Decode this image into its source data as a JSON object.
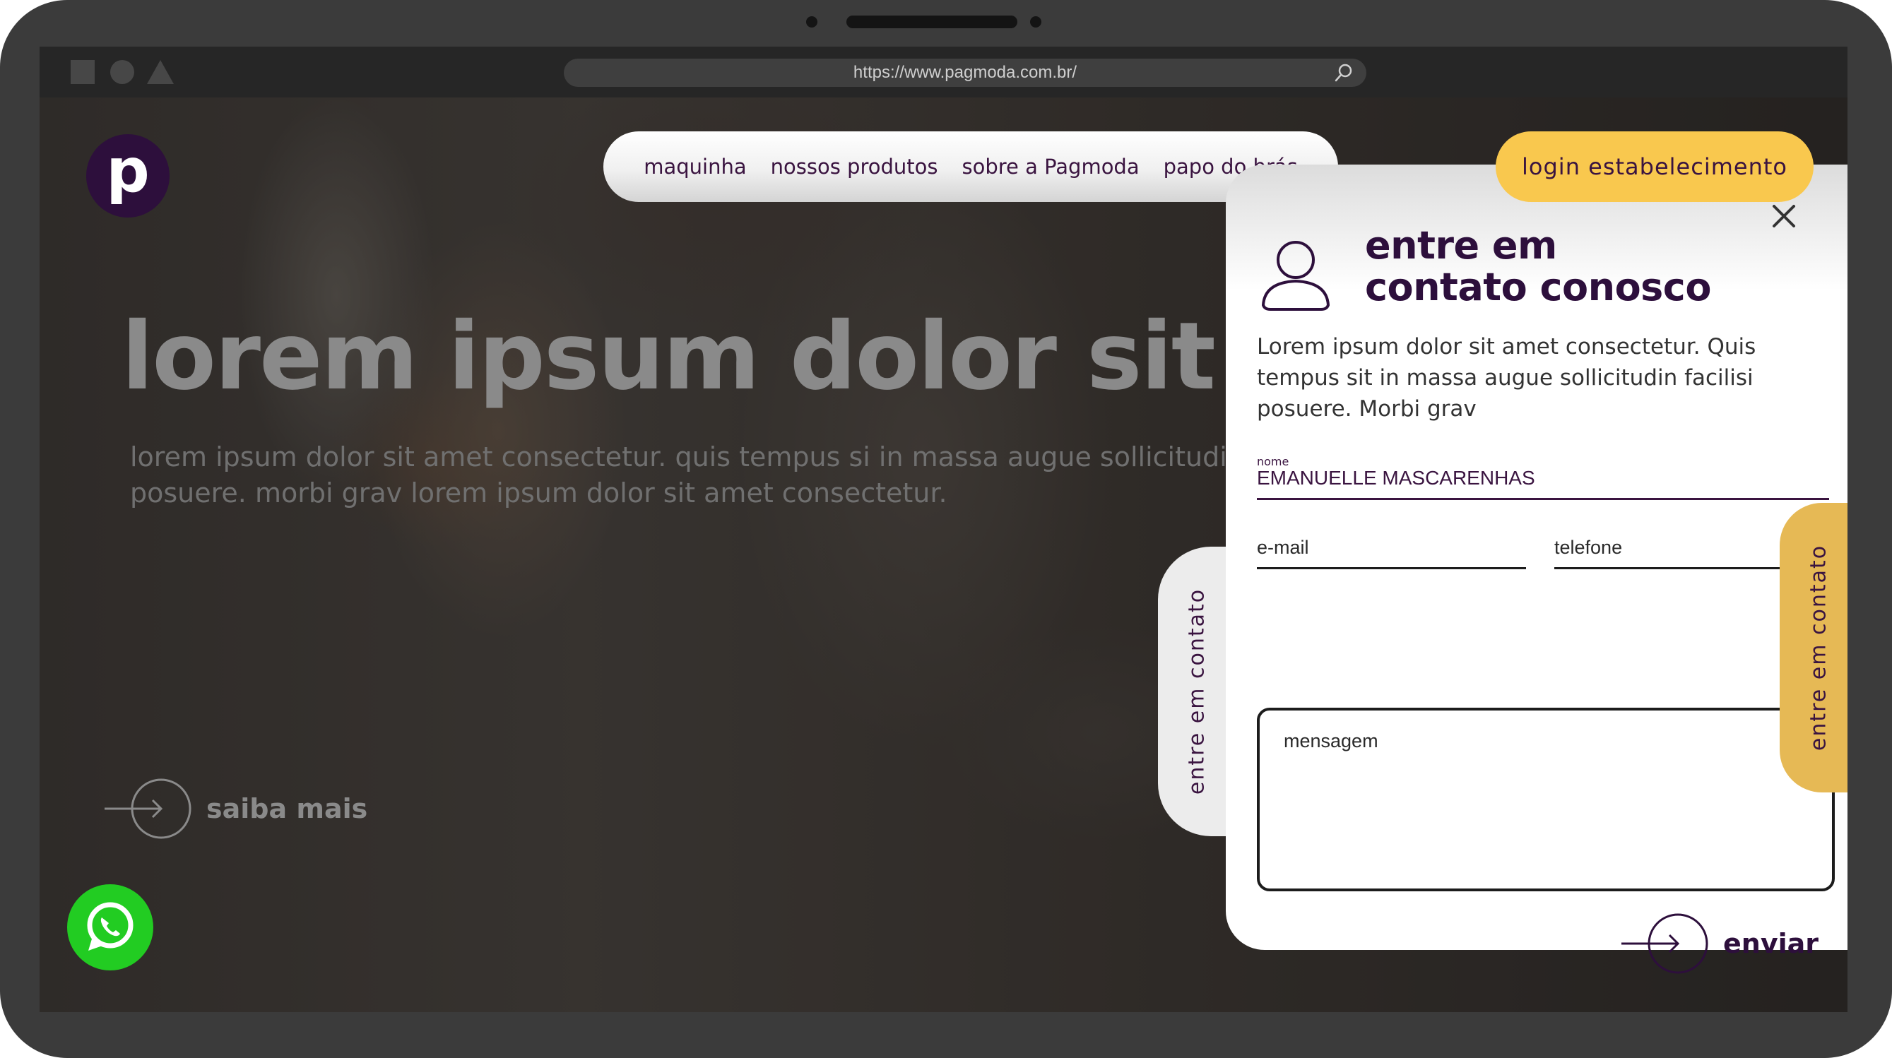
{
  "browser": {
    "url": "https://www.pagmoda.com.br/"
  },
  "site": {
    "logo_letter": "p",
    "nav": [
      {
        "label": "maquinha"
      },
      {
        "label": "nossos produtos"
      },
      {
        "label": "sobre a Pagmoda"
      },
      {
        "label": "papo do brás"
      }
    ],
    "login_label": "login estabelecimento"
  },
  "hero": {
    "title": "lorem ipsum dolor sit",
    "subtitle": "lorem ipsum dolor sit amet consectetur. quis tempus si in massa augue sollicitudi\nposuere. morbi grav lorem ipsum dolor sit amet consectetur.",
    "cta_label": "saiba mais"
  },
  "side_tabs": {
    "left_label": "entre em contato",
    "right_label": "entre em contato"
  },
  "contact_modal": {
    "title": "entre em\ncontato conosco",
    "description": "Lorem ipsum dolor sit amet consectetur. Quis tempus sit in massa augue sollicitudin facilisi posuere. Morbi grav",
    "name_label": "nome",
    "name_value": "EMANUELLE MASCARENHAS",
    "email_label": "e-mail",
    "phone_label": "telefone",
    "message_label": "mensagem",
    "send_label": "enviar"
  },
  "icons": {
    "logo": "pagmoda-logo",
    "close": "close-icon",
    "user": "user-icon",
    "arrow": "arrow-right-icon",
    "whatsapp": "whatsapp-icon",
    "search": "search-icon"
  },
  "colors": {
    "brand_purple": "#2d0f3c",
    "accent_yellow": "#f9c84e",
    "tab_gold": "#e6b955",
    "whatsapp_green": "#22cc22"
  }
}
